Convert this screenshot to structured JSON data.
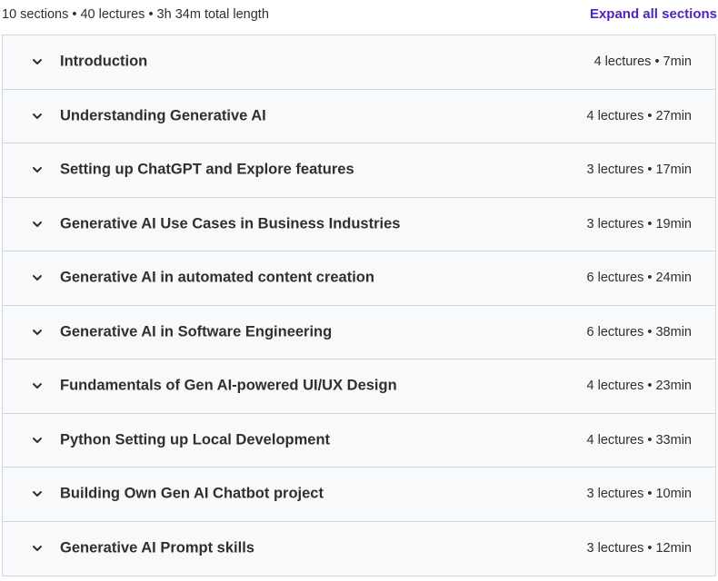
{
  "summary": {
    "text": "10 sections • 40 lectures • 3h 34m total length",
    "expand_label": "Expand all sections"
  },
  "colors": {
    "accent": "#5022c3",
    "row_background": "#f7f9fa",
    "border": "#d1d7dc",
    "text": "#2d2f31"
  },
  "sections": [
    {
      "title": "Introduction",
      "meta": "4 lectures • 7min",
      "icon": "chevron-down-icon"
    },
    {
      "title": "Understanding Generative AI",
      "meta": "4 lectures • 27min",
      "icon": "chevron-down-icon"
    },
    {
      "title": "Setting up ChatGPT and Explore features",
      "meta": "3 lectures • 17min",
      "icon": "chevron-down-icon"
    },
    {
      "title": "Generative AI Use Cases in Business Industries",
      "meta": "3 lectures • 19min",
      "icon": "chevron-down-icon"
    },
    {
      "title": "Generative AI in automated content creation",
      "meta": "6 lectures • 24min",
      "icon": "chevron-down-icon"
    },
    {
      "title": "Generative AI in Software Engineering",
      "meta": "6 lectures • 38min",
      "icon": "chevron-down-icon"
    },
    {
      "title": "Fundamentals of Gen AI-powered UI/UX Design",
      "meta": "4 lectures • 23min",
      "icon": "chevron-down-icon"
    },
    {
      "title": "Python Setting up Local Development",
      "meta": "4 lectures • 33min",
      "icon": "chevron-down-icon"
    },
    {
      "title": "Building Own Gen AI Chatbot project",
      "meta": "3 lectures • 10min",
      "icon": "chevron-down-icon"
    },
    {
      "title": "Generative AI Prompt skills",
      "meta": "3 lectures • 12min",
      "icon": "chevron-down-icon"
    }
  ]
}
